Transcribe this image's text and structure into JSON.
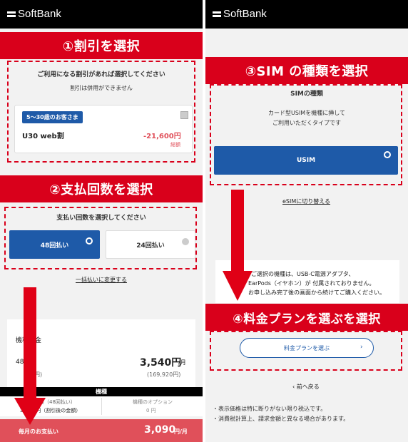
{
  "brand": "SoftBank",
  "left": {
    "step1": {
      "banner": "①割引を選択",
      "intro": "ご利用になる割引があれば選択してください",
      "note": "割引は併用ができません",
      "badge": "5～30歳のお客さま",
      "discount_name": "U30 web割",
      "discount_amount": "-21,600円",
      "discount_unit": "総額"
    },
    "step2": {
      "banner": "②支払回数を選択",
      "intro": "支払い回数を選択してください",
      "option_48": "48回払い",
      "option_24": "24回払い",
      "switch_link": "一括払いに変更する"
    },
    "summary": {
      "row1_label": "機種代金",
      "row2_label": "48回割",
      "monthly_price": "3,540円",
      "monthly_unit": "/月",
      "total_price": "(169,920円)",
      "total_hidden": "円)",
      "table_header": "機種",
      "col1_label": "機種代金（48回払い）",
      "col1_value": "3,090 円（割引後の金額）",
      "col2_label": "機種のオプション",
      "col2_value": "0 円",
      "pay_label": "毎月のお支払い",
      "pay_value": "3,090",
      "pay_unit": "円/月"
    }
  },
  "right": {
    "step3": {
      "banner": "③SIM の種類を選択",
      "title": "SIMの種類",
      "desc1": "カード型USIMを機種に挿して",
      "desc2": "ご利用いただくタイプです",
      "usim_button": "USIM",
      "esim_link": "eSIMに切り替える"
    },
    "notice": {
      "line1": "ご選択の機種は、USB-C電源アダプタ、",
      "line2": "EarPods（イヤホン）が 付属されておりません。",
      "line3": "お申し込み完了後の画面から続けてご購入ください。"
    },
    "step4": {
      "banner": "④料金プランを選ぶを選択",
      "plan_button": "料金プランを選ぶ"
    },
    "back_link": "前へ戻る",
    "footnote1": "・表示価格は特に断りがない限り税込です。",
    "footnote2": "・消費税計算上、請求金額と異なる場合があります。"
  },
  "colors": {
    "accent_red": "#d9001b",
    "brand_blue": "#1e5aa8",
    "price_red": "#e0505a"
  }
}
